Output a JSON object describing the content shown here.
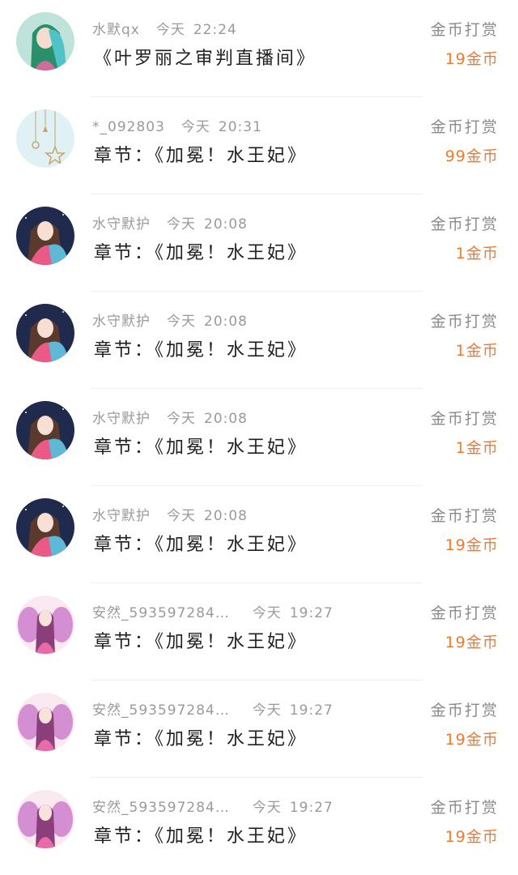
{
  "rewards": [
    {
      "user": "水默qx",
      "date": "今天",
      "time": "22:24",
      "title": "《叶罗丽之审判直播间》",
      "action": "金币打赏",
      "amount": "19金币",
      "avatar_icon": "girl-green-hair-avatar-icon"
    },
    {
      "user": "*_092803",
      "date": "今天",
      "time": "20:31",
      "title": "章节：《加冕！水王妃》",
      "action": "金币打赏",
      "amount": "99金币",
      "avatar_icon": "hanging-ornaments-avatar-icon"
    },
    {
      "user": "水守默护",
      "date": "今天",
      "time": "20:08",
      "title": "章节：《加冕！水王妃》",
      "action": "金币打赏",
      "amount": "1金币",
      "avatar_icon": "girl-pink-dress-avatar-icon"
    },
    {
      "user": "水守默护",
      "date": "今天",
      "time": "20:08",
      "title": "章节：《加冕！水王妃》",
      "action": "金币打赏",
      "amount": "1金币",
      "avatar_icon": "girl-pink-dress-avatar-icon"
    },
    {
      "user": "水守默护",
      "date": "今天",
      "time": "20:08",
      "title": "章节：《加冕！水王妃》",
      "action": "金币打赏",
      "amount": "1金币",
      "avatar_icon": "girl-pink-dress-avatar-icon"
    },
    {
      "user": "水守默护",
      "date": "今天",
      "time": "20:08",
      "title": "章节：《加冕！水王妃》",
      "action": "金币打赏",
      "amount": "19金币",
      "avatar_icon": "girl-pink-dress-avatar-icon"
    },
    {
      "user": "安然_593597284…",
      "date": "今天",
      "time": "19:27",
      "title": "章节：《加冕！水王妃》",
      "action": "金币打赏",
      "amount": "19金币",
      "avatar_icon": "purple-fairy-avatar-icon"
    },
    {
      "user": "安然_593597284…",
      "date": "今天",
      "time": "19:27",
      "title": "章节：《加冕！水王妃》",
      "action": "金币打赏",
      "amount": "19金币",
      "avatar_icon": "purple-fairy-avatar-icon"
    },
    {
      "user": "安然_593597284…",
      "date": "今天",
      "time": "19:27",
      "title": "章节：《加冕！水王妃》",
      "action": "金币打赏",
      "amount": "19金币",
      "avatar_icon": "purple-fairy-avatar-icon"
    }
  ],
  "colors": {
    "reward_amount": "#ee7a2a",
    "meta_text": "#9a9a9a",
    "title_text": "#1f1f1f",
    "divider": "#efefef"
  }
}
